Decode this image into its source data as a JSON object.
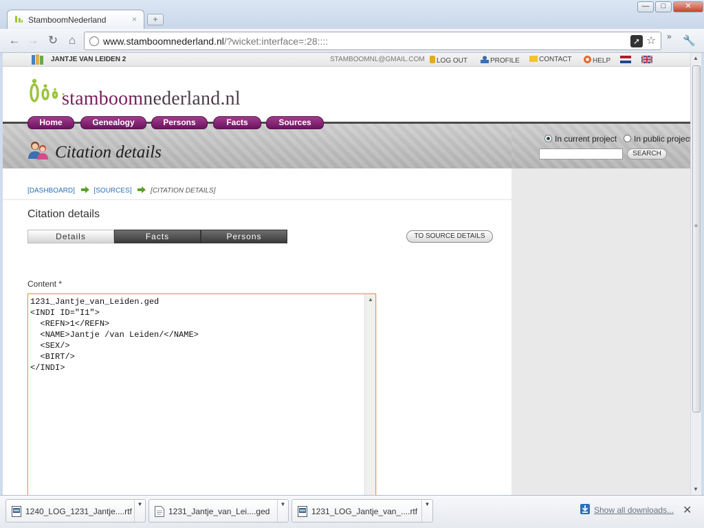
{
  "browser": {
    "tab_title": "StamboomNederland",
    "tab_close": "×",
    "new_tab": "+",
    "window_buttons": {
      "minimize": "—",
      "maximize": "□",
      "close": "✕"
    },
    "url_host": "www.stamboomnederland.nl",
    "url_path": "/?wicket:interface=:28::::",
    "icons": [
      "back-icon",
      "forward-icon",
      "reload-icon",
      "home-icon",
      "globe-icon",
      "page-action-icon",
      "star-icon",
      "wrench-icon"
    ]
  },
  "topbar": {
    "project_name": "JANTJE VAN LEIDEN 2",
    "email": "STAMBOOMNL@GMAIL.COM",
    "logout": "LOG OUT",
    "profile": "PROFILE",
    "contact": "CONTACT",
    "help": "HELP"
  },
  "logo": {
    "part1": "stamboom",
    "part2": "nederland.nl"
  },
  "nav": {
    "items": [
      {
        "label": "Home"
      },
      {
        "label": "Genealogy"
      },
      {
        "label": "Persons"
      },
      {
        "label": "Facts"
      },
      {
        "label": "Sources"
      }
    ],
    "color": "#7a1e6c"
  },
  "banner": {
    "title": "Citation details",
    "radio_current": "In current project",
    "radio_public": "In public project",
    "radio_selected": "current",
    "search_value": "",
    "search_button": "SEARCH"
  },
  "breadcrumb": {
    "dashboard": "[DASHBOARD]",
    "sources": "[SOURCES]",
    "current": "[CITATION DETAILS]"
  },
  "main": {
    "section_title": "Citation details",
    "tabs": [
      {
        "label": "Details",
        "active": true
      },
      {
        "label": "Facts",
        "active": false
      },
      {
        "label": "Persons",
        "active": false
      }
    ],
    "to_source_button": "TO SOURCE DETAILS",
    "content_label": "Content *",
    "content_value": "1231_Jantje_van_Leiden.ged\n<INDI ID=\"I1\">\n  <REFN>1</REFN>\n  <NAME>Jantje /van Leiden/</NAME>\n  <SEX/>\n  <BIRT/>\n</INDI>"
  },
  "downloads": {
    "items": [
      {
        "name": "1240_LOG_1231_Jantje....rtf",
        "type": "rtf"
      },
      {
        "name": "1231_Jantje_van_Lei....ged",
        "type": "ged"
      },
      {
        "name": "1231_LOG_Jantje_van_....rtf",
        "type": "rtf"
      }
    ],
    "show_all": "Show all downloads...",
    "close": "✕"
  }
}
